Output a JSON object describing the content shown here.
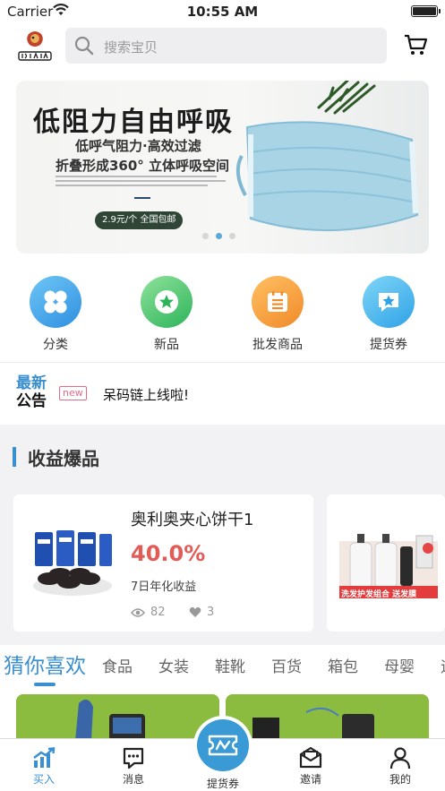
{
  "status_bar": {
    "carrier": "Carrier",
    "time": "10:55 AM"
  },
  "header": {
    "logo_text": "CAIMA",
    "search_placeholder": "搜索宝贝"
  },
  "banner": {
    "title": "低阻力自由呼吸",
    "subtitle1": "低呼气阻力·高效过滤",
    "subtitle2": "折叠形成360° 立体呼吸空间",
    "price_tag": "2.9元/个  全国包邮",
    "pages": 3,
    "active_page": 2
  },
  "categories": [
    {
      "label": "分类",
      "icon": "clover-icon"
    },
    {
      "label": "新品",
      "icon": "star-badge-icon"
    },
    {
      "label": "批发商品",
      "icon": "calendar-list-icon"
    },
    {
      "label": "提货券",
      "icon": "star-chat-icon"
    }
  ],
  "notice": {
    "label_top": "最新",
    "label_bottom": "公告",
    "tag": "new",
    "message": "呆码链上线啦!"
  },
  "section": {
    "title": "收益爆品"
  },
  "products": [
    {
      "name": "奥利奥夹心饼干1",
      "rate": "40.0%",
      "rate_label": "7日年化收益",
      "views": "82",
      "likes": "3"
    },
    {
      "name": "洗发护发组合 送发膜"
    }
  ],
  "tabs": [
    "猜你喜欢",
    "食品",
    "女装",
    "鞋靴",
    "百货",
    "箱包",
    "母婴",
    "运"
  ],
  "active_tab": 0,
  "tabbar": [
    {
      "label": "买入",
      "icon": "chart-up-icon",
      "active": true
    },
    {
      "label": "消息",
      "icon": "message-icon",
      "active": false
    },
    {
      "label": "提货券",
      "icon": "ticket-icon",
      "active": false
    },
    {
      "label": "邀请",
      "icon": "invite-icon",
      "active": false
    },
    {
      "label": "我的",
      "icon": "person-icon",
      "active": false
    }
  ],
  "colors": {
    "accent": "#3a8fd0",
    "rate": "#e25b57",
    "new_tag": "#e46a8a"
  }
}
